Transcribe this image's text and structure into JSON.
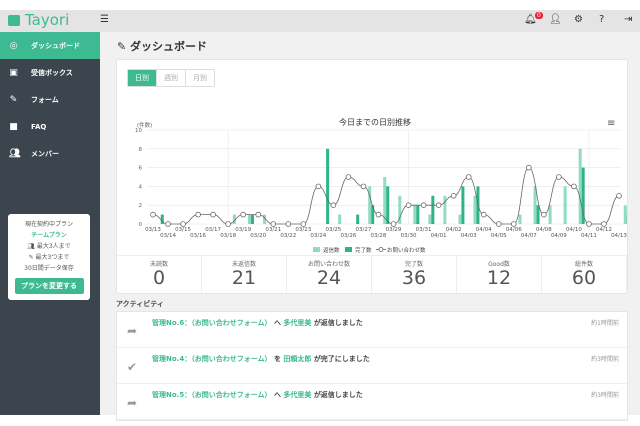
{
  "header": {
    "logo": "Tayori",
    "notifications": "0"
  },
  "sidebar": {
    "items": [
      {
        "label": "ダッシュボード",
        "icon": "dashboard-icon"
      },
      {
        "label": "受信ボックス",
        "icon": "inbox-icon"
      },
      {
        "label": "フォーム",
        "icon": "form-icon"
      },
      {
        "label": "FAQ",
        "icon": "book-icon"
      },
      {
        "label": "メンバー",
        "icon": "users-icon"
      }
    ],
    "plan": {
      "heading": "現在契約中プラン",
      "name": "チームプラン",
      "members": "最大3人まで",
      "forms": "最大3つまで",
      "retention": "30日間データ保存",
      "button": "プランを変更する"
    }
  },
  "main": {
    "title": "ダッシュボード",
    "tabs": [
      "日別",
      "週別",
      "月別"
    ],
    "stats": [
      {
        "label": "未読数",
        "value": "0"
      },
      {
        "label": "未返信数",
        "value": "21"
      },
      {
        "label": "お問い合わせ数",
        "value": "24"
      },
      {
        "label": "完了数",
        "value": "36"
      },
      {
        "label": "Good数",
        "value": "12"
      },
      {
        "label": "総件数",
        "value": "60"
      }
    ],
    "activity_title": "アクティビティ",
    "activities": [
      {
        "icon": "reply-icon",
        "ticket": "管理No.6：",
        "form": "（お問い合わせフォーム）",
        "particle": "へ",
        "user": "多代里美",
        "action": "が返信しました",
        "time": "約1時間前"
      },
      {
        "icon": "check-icon",
        "ticket": "管理No.4：",
        "form": "（お問い合わせフォーム）",
        "particle": "を",
        "user": "田頼太郎",
        "action": "が完了にしました",
        "time": "約3時間前"
      },
      {
        "icon": "reply-icon",
        "ticket": "管理No.5：",
        "form": "（お問い合わせフォーム）",
        "particle": "へ",
        "user": "多代里美",
        "action": "が返信しました",
        "time": "約3時間前"
      }
    ]
  },
  "chart_data": {
    "type": "bar",
    "title": "今日までの日別推移",
    "ylabel": "(件数)",
    "ylim": [
      0,
      10
    ],
    "yticks": [
      0,
      2,
      4,
      6,
      8,
      10
    ],
    "categories": [
      "03/13",
      "03/14",
      "03/15",
      "03/16",
      "03/17",
      "03/18",
      "03/19",
      "03/20",
      "03/21",
      "03/22",
      "03/23",
      "03/24",
      "03/25",
      "03/26",
      "03/27",
      "03/28",
      "03/29",
      "03/30",
      "03/31",
      "04/01",
      "04/02",
      "04/03",
      "04/04",
      "04/05",
      "04/06",
      "04/07",
      "04/08",
      "04/09",
      "04/10",
      "04/11",
      "04/12",
      "04/13"
    ],
    "series": [
      {
        "name": "返信数",
        "type": "bar",
        "color": "#8fdcc0",
        "values": [
          0,
          0,
          0,
          0,
          0,
          1,
          1,
          1,
          0,
          0,
          0,
          0,
          1,
          0,
          4,
          5,
          3,
          2,
          1,
          3,
          1,
          3,
          0,
          0,
          1,
          4,
          2,
          4,
          8,
          0,
          0,
          2
        ]
      },
      {
        "name": "完了数",
        "type": "bar",
        "color": "#2fb38a",
        "values": [
          1,
          0,
          0,
          0,
          0,
          0,
          1,
          0,
          0,
          0,
          0,
          8,
          0,
          1,
          2,
          4,
          0,
          2,
          3,
          0,
          4,
          4,
          0,
          0,
          0,
          2,
          0,
          0,
          6,
          0,
          0,
          1
        ]
      },
      {
        "name": "お問い合わせ数",
        "type": "line",
        "color": "#666666",
        "values": [
          1,
          0,
          0,
          1,
          1,
          0,
          1,
          1,
          0,
          0,
          0,
          4,
          2,
          5,
          4,
          1,
          0,
          2,
          2,
          2,
          3,
          5,
          1,
          0,
          0,
          6,
          1,
          5,
          4,
          0,
          0,
          3
        ]
      }
    ]
  }
}
